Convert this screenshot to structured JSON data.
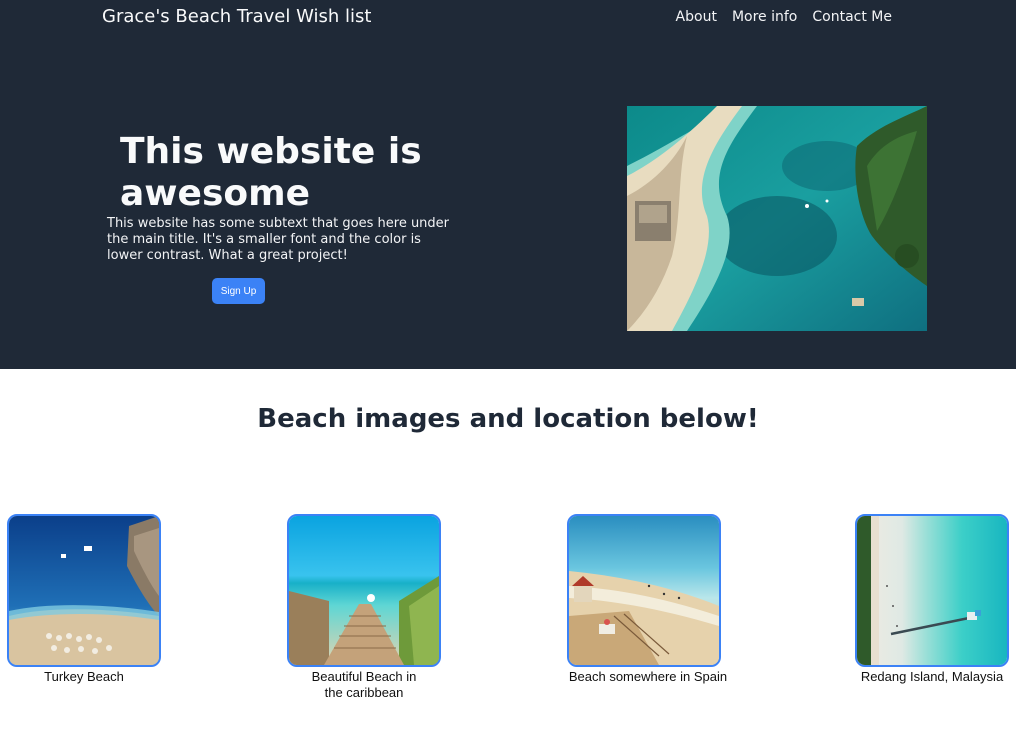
{
  "header": {
    "brand": "Grace's Beach Travel Wish list",
    "nav": [
      "About",
      "More info",
      "Contact Me"
    ]
  },
  "hero": {
    "title": "This website is awesome",
    "subtext": "This website has some subtext that goes here under the main title. It's a smaller font and the color is lower contrast. What a great project!",
    "button_label": "Sign Up"
  },
  "gallery": {
    "heading": "Beach images and location below!",
    "cards": [
      {
        "caption": "Turkey Beach"
      },
      {
        "caption": "Beautiful Beach in the caribbean"
      },
      {
        "caption": "Beach somewhere in Spain"
      },
      {
        "caption": "Redang Island, Malaysia"
      }
    ]
  },
  "colors": {
    "hero_background": "#1f2937",
    "accent": "#3b82f6",
    "heading_text": "#1f2937"
  }
}
